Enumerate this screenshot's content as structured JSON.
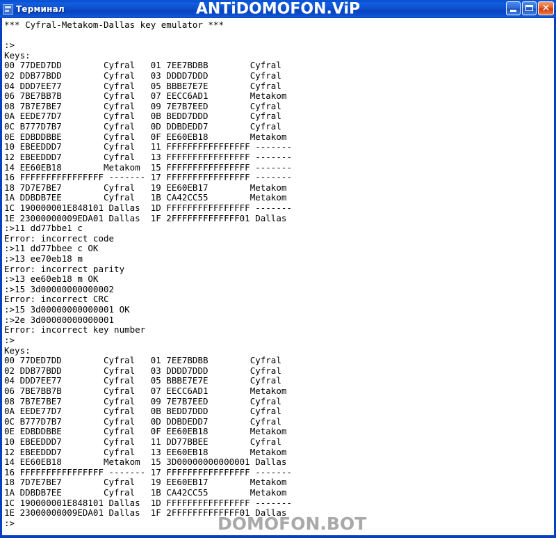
{
  "window": {
    "title": "Терминал",
    "watermark_title": "ANTiDOMOFON.ViP",
    "watermark_footer": "DOMOFON.BOT",
    "icon": "terminal-icon",
    "controls": {
      "minimize": "_",
      "maximize": "□",
      "close": "✕"
    },
    "colors": {
      "titlebar": "#0f52cf",
      "border": "#0a3fc0",
      "client_bg": "#ffffff",
      "text": "#000000",
      "close_button": "#cf3d10",
      "watermark_footer": "#a9a9a9"
    }
  },
  "terminal": {
    "lines": [
      "*** Cyfral-Metakom-Dallas key emulator ***",
      "",
      ":>",
      "Keys:",
      "00 77DED7DD        Cyfral   01 7EE7BDBB        Cyfral",
      "02 DDB77BDD        Cyfral   03 DDDD7DDD        Cyfral",
      "04 DDD7EE77        Cyfral   05 BBBE7E7E        Cyfral",
      "06 7BE7BB7B        Cyfral   07 EECC6AD1        Metakom",
      "08 7B7E7BE7        Cyfral   09 7E7B7EED        Cyfral",
      "0A EEDE77D7        Cyfral   0B BEDD7DDD        Cyfral",
      "0C B777D7B7        Cyfral   0D DDBDEDD7        Cyfral",
      "0E EDBDDBBE        Cyfral   0F EE60EB18        Metakom",
      "10 EBEEDDD7        Cyfral   11 FFFFFFFFFFFFFFFF -------",
      "12 EBEEDDD7        Cyfral   13 FFFFFFFFFFFFFFFF -------",
      "14 EE60EB18        Metakom  15 FFFFFFFFFFFFFFFF -------",
      "16 FFFFFFFFFFFFFFFF ------- 17 FFFFFFFFFFFFFFFF -------",
      "18 7D7E7BE7        Cyfral   19 EE60EB17        Metakom",
      "1A DDBDB7EE        Cyfral   1B CA42CC55        Metakom",
      "1C 190000001E848101 Dallas  1D FFFFFFFFFFFFFFFF -------",
      "1E 23000000009EDA01 Dallas  1F 2FFFFFFFFFFFFF01 Dallas",
      ":>11 dd77bbe1 c",
      "Error: incorrect code",
      ":>11 dd77bbee c OK",
      ":>13 ee70eb18 m",
      "Error: incorrect parity",
      ":>13 ee60eb18 m OK",
      ":>15 3d00000000000002",
      "Error: incorrect CRC",
      ":>15 3d00000000000001 OK",
      ":>2e 3d00000000000001",
      "Error: incorrect key number",
      ":>",
      "Keys:",
      "00 77DED7DD        Cyfral   01 7EE7BDBB        Cyfral",
      "02 DDB77BDD        Cyfral   03 DDDD7DDD        Cyfral",
      "04 DDD7EE77        Cyfral   05 BBBE7E7E        Cyfral",
      "06 7BE7BB7B        Cyfral   07 EECC6AD1        Metakom",
      "08 7B7E7BE7        Cyfral   09 7E7B7EED        Cyfral",
      "0A EEDE77D7        Cyfral   0B BEDD7DDD        Cyfral",
      "0C B777D7B7        Cyfral   0D DDBDEDD7        Cyfral",
      "0E EDBDDBBE        Cyfral   0F EE60EB18        Metakom",
      "10 EBEEDDD7        Cyfral   11 DD77BBEE        Cyfral",
      "12 EBEEDDD7        Cyfral   13 EE60EB18        Metakom",
      "14 EE60EB18        Metakom  15 3D00000000000001 Dallas",
      "16 FFFFFFFFFFFFFFFF ------- 17 FFFFFFFFFFFFFFFF -------",
      "18 7D7E7BE7        Cyfral   19 EE60EB17        Metakom",
      "1A DDBDB7EE        Cyfral   1B CA42CC55        Metakom",
      "1C 190000001E848101 Dallas  1D FFFFFFFFFFFFFFFF -------",
      "1E 23000000009EDA01 Dallas  1F 2FFFFFFFFFFFFF01 Dallas",
      ":>"
    ]
  }
}
